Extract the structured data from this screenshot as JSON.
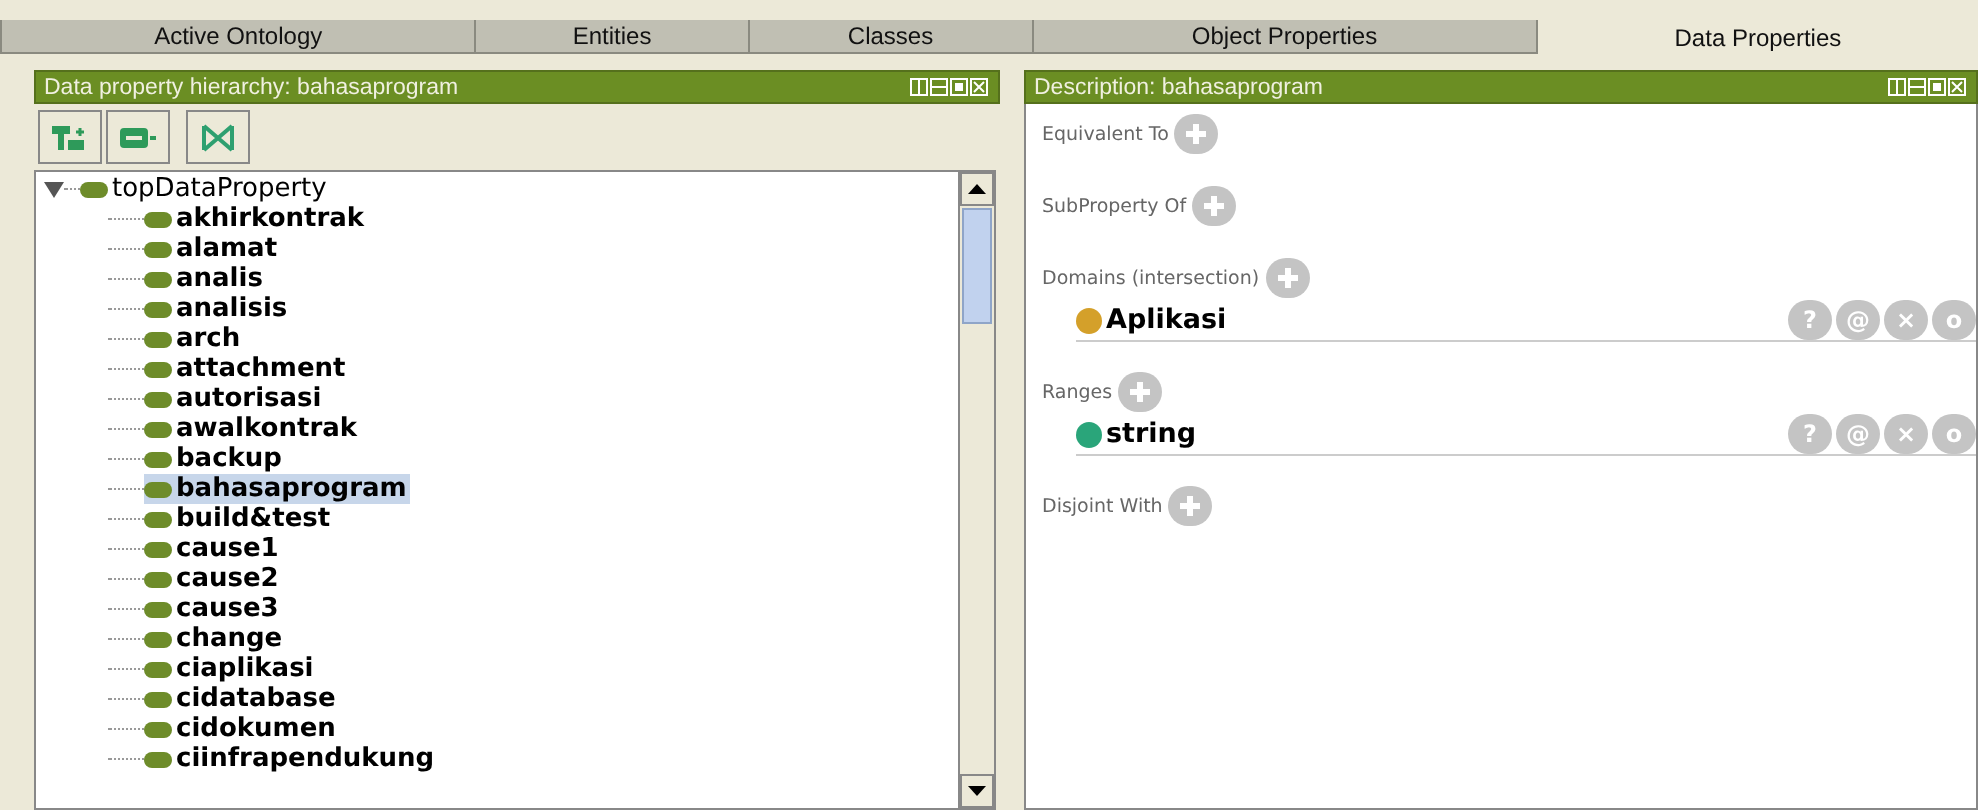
{
  "tabs": [
    {
      "label": "Active Ontology",
      "selected": false
    },
    {
      "label": "Entities",
      "selected": false
    },
    {
      "label": "Classes",
      "selected": false
    },
    {
      "label": "Object Properties",
      "selected": false
    },
    {
      "label": "Data Properties",
      "selected": true
    }
  ],
  "hierarchy": {
    "title": "Data property hierarchy: bahasaprogram",
    "toolbar": [
      {
        "kind": "add-sub"
      },
      {
        "kind": "add-sibling"
      },
      {
        "kind": "delete"
      }
    ],
    "root": {
      "name": "topDataProperty",
      "expanded": true,
      "selected": false,
      "children": [
        {
          "name": "akhirkontrak",
          "selected": false
        },
        {
          "name": "alamat",
          "selected": false
        },
        {
          "name": "analis",
          "selected": false
        },
        {
          "name": "analisis",
          "selected": false
        },
        {
          "name": "arch",
          "selected": false
        },
        {
          "name": "attachment",
          "selected": false
        },
        {
          "name": "autorisasi",
          "selected": false
        },
        {
          "name": "awalkontrak",
          "selected": false
        },
        {
          "name": "backup",
          "selected": false
        },
        {
          "name": "bahasaprogram",
          "selected": true
        },
        {
          "name": "build&test",
          "selected": false
        },
        {
          "name": "cause1",
          "selected": false
        },
        {
          "name": "cause2",
          "selected": false
        },
        {
          "name": "cause3",
          "selected": false
        },
        {
          "name": "change",
          "selected": false
        },
        {
          "name": "ciaplikasi",
          "selected": false
        },
        {
          "name": "cidatabase",
          "selected": false
        },
        {
          "name": "cidokumen",
          "selected": false
        },
        {
          "name": "ciinfrapendukung",
          "selected": false
        }
      ]
    }
  },
  "description": {
    "title": "Description: bahasaprogram",
    "sections": [
      {
        "label": "Equivalent To"
      },
      {
        "label": "SubProperty Of"
      },
      {
        "label": "Domains (intersection)",
        "items": [
          {
            "name": "Aplikasi",
            "color": "#d4a02a",
            "actions": [
              "?",
              "@",
              "×",
              "o"
            ]
          }
        ]
      },
      {
        "label": "Ranges",
        "items": [
          {
            "name": "string",
            "color": "#2aa57a",
            "actions": [
              "?",
              "@",
              "×",
              "o"
            ]
          }
        ]
      },
      {
        "label": "Disjoint With"
      }
    ]
  }
}
